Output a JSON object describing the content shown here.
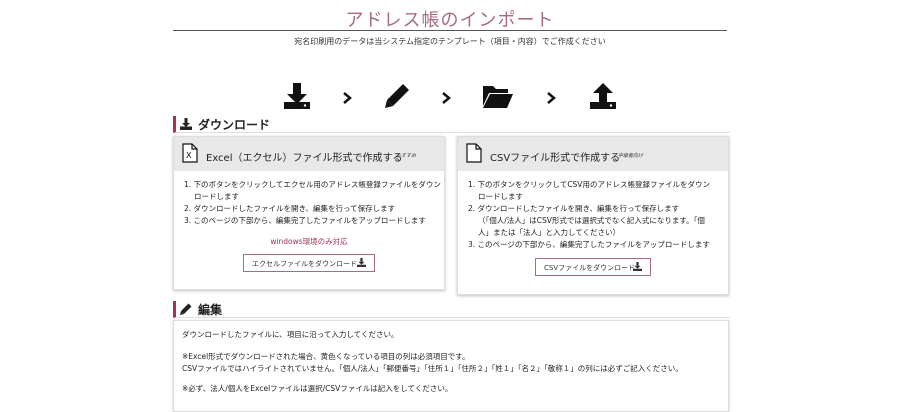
{
  "page": {
    "title": "アドレス帳のインポート",
    "subtitle": "宛名印刷用のデータは当システム指定のテンプレート（項目・内容）でご作成ください"
  },
  "steps_icons": [
    "download-icon",
    "pencil-icon",
    "folder-open-icon",
    "upload-icon"
  ],
  "download_section": {
    "heading": "ダウンロード",
    "excel": {
      "title": "Excel（エクセル）ファイル形式で作成する",
      "note": "おすすめ",
      "steps": [
        "1. 下のボタンをクリックしてエクセル用のアドレス帳登録ファイルをダウン",
        "ロードします",
        "2. ダウンロードしたファイルを開き、編集を行って保存します",
        "3. このページの下部から、編集完了したファイルをアップロードします"
      ],
      "windows_note": "windows環境のみ対応",
      "button_label": "エクセルファイルをダウンロード"
    },
    "csv": {
      "title": "CSVファイル形式で作成する",
      "note": "中級者向け",
      "steps": [
        "1. 下のボタンをクリックしてCSV用のアドレス帳登録ファイルをダウン",
        "ロードします",
        "2. ダウンロードしたファイルを開き、編集を行って保存します",
        "（「個人/法人」はCSV形式では選択式でなく記入式になります。「個",
        "人」または「法人」と入力してください）",
        "3. このページの下部から、編集完了したファイルをアップロードします"
      ],
      "button_label": "CSVファイルをダウンロード"
    }
  },
  "edit_section": {
    "heading": "編集",
    "lines": [
      "ダウンロードしたファイルに、項目に沿って入力してください。",
      "※Excel形式でダウンロードされた場合、黄色くなっている項目の列は必須項目です。",
      "CSVファイルではハイライトされていません。「個人/法人」「郵便番号」「住所１」「住所２」「姓１」「名２」「敬称１」の列には必ずご記入ください。",
      "※必ず、法人/個人をExcelファイルは選択/CSVファイルは記入をしてください。"
    ]
  },
  "colors": {
    "accent": "#a5315a",
    "title": "#a86b85",
    "card_header": "#e8e8e8"
  }
}
